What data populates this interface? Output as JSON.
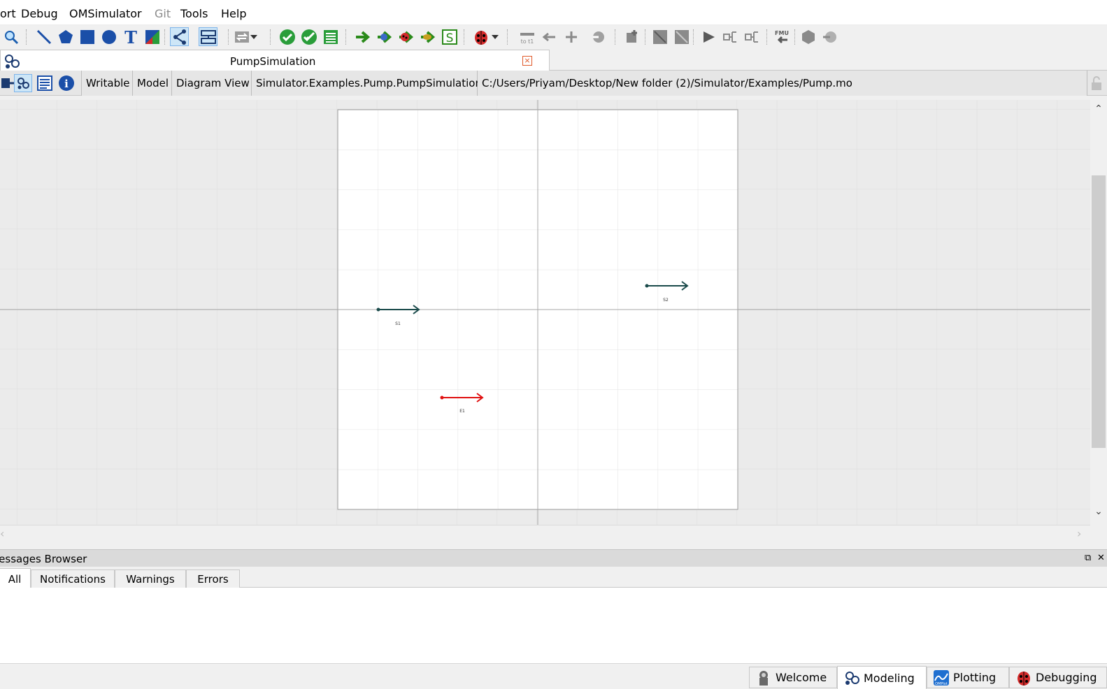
{
  "menubar": {
    "items": [
      "ort",
      "Debug",
      "OMSimulator",
      "Git",
      "Tools",
      "Help"
    ]
  },
  "toolbar": {
    "icons": [
      "zoom-icon",
      "line-icon",
      "polygon-icon",
      "rectangle-icon",
      "ellipse-icon",
      "text-icon",
      "bitmap-icon",
      "connect-mode-icon",
      "transition-mode-icon",
      "swap-icon",
      "check-model-icon",
      "check-all-models-icon",
      "instantiate-model-icon",
      "simulate-icon",
      "simulate-with-transformational-debugger-icon",
      "simulate-with-algorithmic-debugger-icon",
      "simulate-with-animation-icon",
      "sensitivity-icon",
      "debug-configurations-icon",
      "fmu-export-icon",
      "fmu-import-icon"
    ]
  },
  "tab": {
    "title": "PumpSimulation",
    "close": "×"
  },
  "infobar": {
    "writable": "Writable",
    "model": "Model",
    "view": "Diagram View",
    "class_name": "Simulator.Examples.Pump.PumpSimulation",
    "file_path": "C:/Users/Priyam/Desktop/New folder (2)/Simulator/Examples/Pump.mo"
  },
  "diagram": {
    "components": [
      {
        "label": "S1",
        "color": "#1a4a4a"
      },
      {
        "label": "S2",
        "color": "#1a4a4a"
      },
      {
        "label": "E1",
        "color": "#e01010"
      }
    ]
  },
  "messages": {
    "title": "lessages Browser",
    "tabs": [
      "All",
      "Notifications",
      "Warnings",
      "Errors"
    ],
    "selected_tab": "All"
  },
  "perspectives": {
    "items": [
      "Welcome",
      "Modeling",
      "Plotting",
      "Debugging"
    ],
    "selected": "Modeling"
  }
}
